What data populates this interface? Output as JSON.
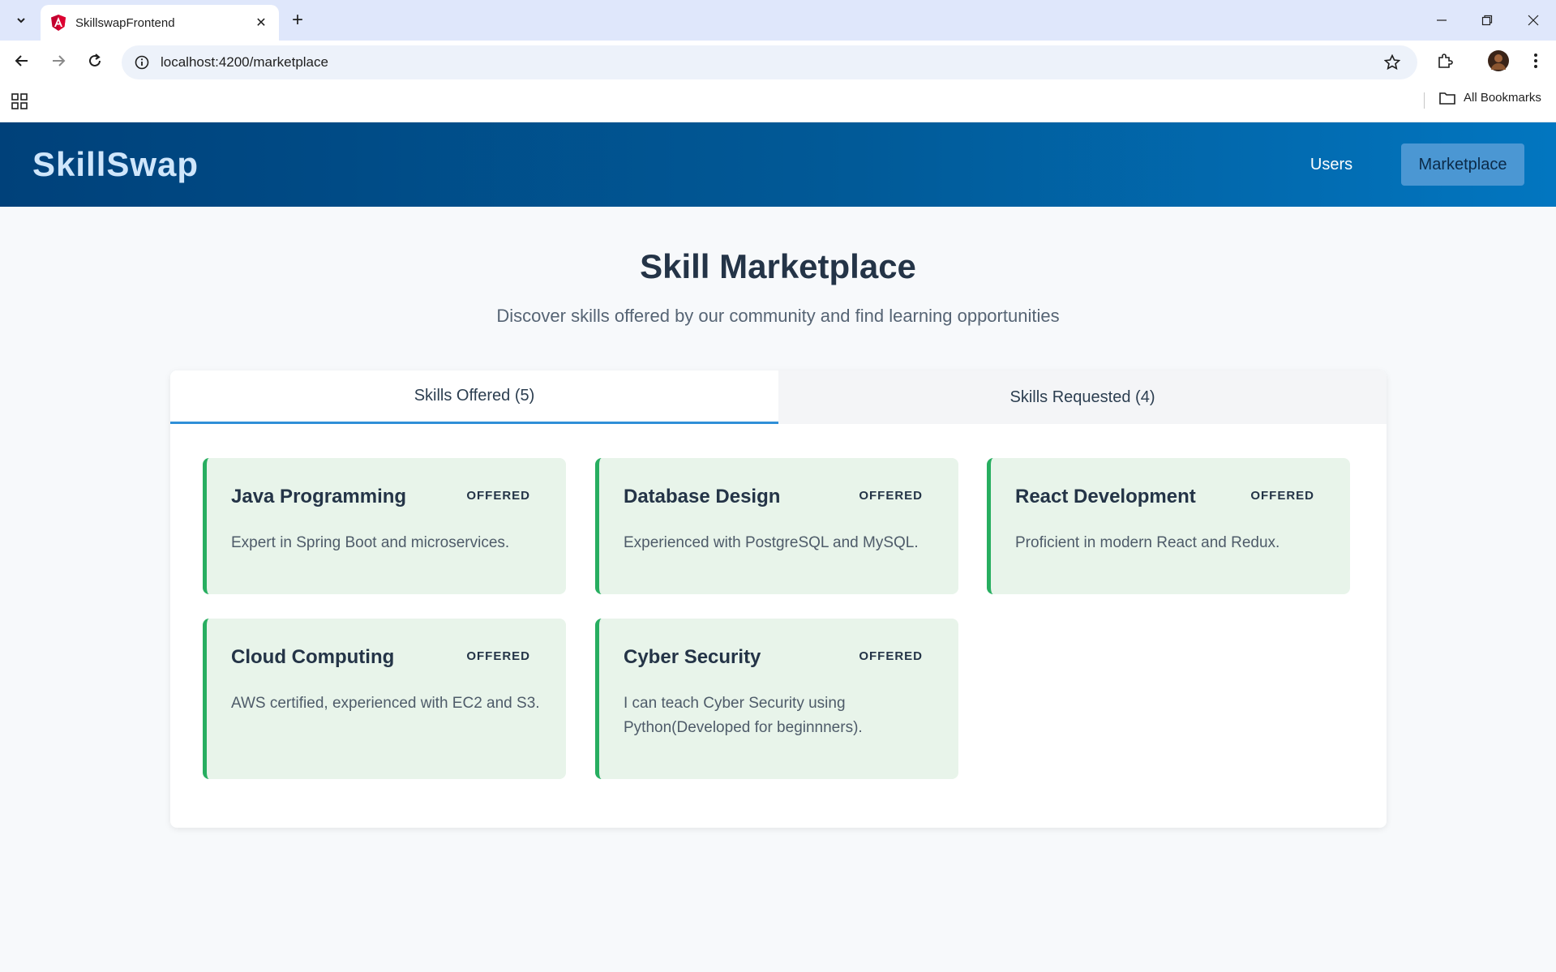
{
  "browser": {
    "tab_title": "SkillswapFrontend",
    "url": "localhost:4200/marketplace",
    "bookmarks_label": "All Bookmarks"
  },
  "header": {
    "brand": "SkillSwap",
    "nav": {
      "users": "Users",
      "marketplace": "Marketplace"
    }
  },
  "page": {
    "title": "Skill Marketplace",
    "subtitle": "Discover skills offered by our community and find learning opportunities"
  },
  "tabs": [
    {
      "label": "Skills Offered (5)",
      "active": true
    },
    {
      "label": "Skills Requested (4)",
      "active": false
    }
  ],
  "skills": [
    {
      "title": "Java Programming",
      "badge": "OFFERED",
      "description": "Expert in Spring Boot and microservices."
    },
    {
      "title": "Database Design",
      "badge": "OFFERED",
      "description": "Experienced with PostgreSQL and MySQL."
    },
    {
      "title": "React Development",
      "badge": "OFFERED",
      "description": "Proficient in modern React and Redux."
    },
    {
      "title": "Cloud Computing",
      "badge": "OFFERED",
      "description": "AWS certified, experienced with EC2 and S3."
    },
    {
      "title": "Cyber Security",
      "badge": "OFFERED",
      "description": "I can teach Cyber Security using Python(Developed for beginnners)."
    }
  ]
}
